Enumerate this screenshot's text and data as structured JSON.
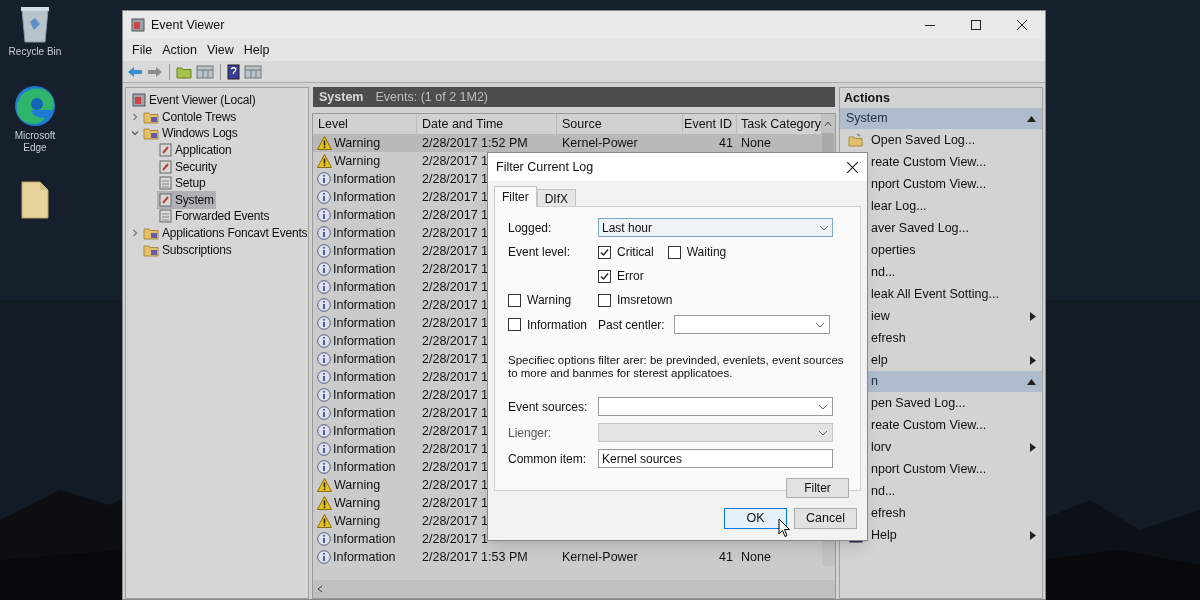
{
  "desktop": {
    "icons": [
      {
        "kind": "bin",
        "label": "Recycle Bin"
      },
      {
        "kind": "browser",
        "label": "Microsoft Edge"
      },
      {
        "kind": "file"
      }
    ]
  },
  "window": {
    "title": "Event Viewer"
  },
  "menu": [
    "File",
    "Action",
    "View",
    "Help"
  ],
  "tree": [
    {
      "label": "Event Viewer (Local)",
      "kind": "root",
      "selected": false,
      "children": [
        {
          "label": "Contole Trews",
          "kind": "folder",
          "selected": false,
          "expanded": false
        },
        {
          "label": "Windows Logs",
          "kind": "folder",
          "selected": false,
          "expanded": true,
          "children": [
            {
              "label": "Application",
              "kind": "log",
              "selected": false
            },
            {
              "label": "Security",
              "kind": "log",
              "selected": false
            },
            {
              "label": "Setup",
              "kind": "plain",
              "selected": false
            },
            {
              "label": "System",
              "kind": "log",
              "selected": true
            },
            {
              "label": "Forwarded Events",
              "kind": "plain",
              "selected": false
            }
          ]
        },
        {
          "label": "Applications Foncavt Events",
          "kind": "folder",
          "selected": false,
          "expanded": false
        },
        {
          "label": "Subscriptions",
          "kind": "folder",
          "selected": false
        }
      ]
    }
  ],
  "log_header": {
    "title": "System",
    "events": "Events: (1 of 2 1M2)"
  },
  "table": {
    "columns": [
      "Level",
      "Date and Time",
      "Source",
      "Event ID",
      "Task Category"
    ],
    "rows": [
      {
        "kind": "warning",
        "level": "Warning",
        "date": "2/28/2017 1:52 PM",
        "source": "Kernel-Power",
        "event_id": "41",
        "task_category": "None",
        "selected": true
      },
      {
        "kind": "warning",
        "level": "Warning",
        "date": "2/28/2017 1",
        "selected": false
      },
      {
        "kind": "info",
        "level": "Information",
        "date": "2/28/2017 1",
        "selected": false
      },
      {
        "kind": "info",
        "level": "Information",
        "date": "2/28/2017 1",
        "selected": false
      },
      {
        "kind": "info",
        "level": "Information",
        "date": "2/28/2017 1",
        "selected": false
      },
      {
        "kind": "info",
        "level": "Information",
        "date": "2/28/2017 1",
        "selected": false
      },
      {
        "kind": "info",
        "level": "Information",
        "date": "2/28/2017 1",
        "selected": false
      },
      {
        "kind": "info",
        "level": "Information",
        "date": "2/28/2017 1",
        "selected": false
      },
      {
        "kind": "info",
        "level": "Information",
        "date": "2/28/2017 1",
        "selected": false
      },
      {
        "kind": "info",
        "level": "Information",
        "date": "2/28/2017 1",
        "selected": false
      },
      {
        "kind": "info",
        "level": "Information",
        "date": "2/28/2017 1",
        "selected": false
      },
      {
        "kind": "info",
        "level": "Information",
        "date": "2/28/2017 1",
        "selected": false
      },
      {
        "kind": "info",
        "level": "Information",
        "date": "2/28/2017 1",
        "selected": false
      },
      {
        "kind": "info",
        "level": "Information",
        "date": "2/28/2017 1",
        "selected": false
      },
      {
        "kind": "info",
        "level": "Information",
        "date": "2/28/2017 1",
        "selected": false
      },
      {
        "kind": "info",
        "level": "Information",
        "date": "2/28/2017 1",
        "selected": false
      },
      {
        "kind": "info",
        "level": "Information",
        "date": "2/28/2017 1",
        "selected": false
      },
      {
        "kind": "info",
        "level": "Information",
        "date": "2/28/2017 1",
        "selected": false
      },
      {
        "kind": "info",
        "level": "Information",
        "date": "2/28/2017 1",
        "selected": false
      },
      {
        "kind": "warning",
        "level": "Warning",
        "date": "2/28/2017 1",
        "selected": false
      },
      {
        "kind": "warning",
        "level": "Warning",
        "date": "2/28/2017 1",
        "selected": false
      },
      {
        "kind": "warning",
        "level": "Warning",
        "date": "2/28/2017 1",
        "selected": false
      },
      {
        "kind": "info",
        "level": "Information",
        "date": "2/28/2017 1",
        "selected": false
      },
      {
        "kind": "info",
        "level": "Information",
        "date": "2/28/2017 1:53 PM",
        "source": "Kernel-Power",
        "event_id": "41",
        "task_category": "None",
        "selected": false
      }
    ]
  },
  "actions": {
    "title": "Actions",
    "sections": [
      {
        "title": "System",
        "expanded": true,
        "items": [
          {
            "label": "Open Saved Log...",
            "kind": "folder",
            "submenu": false
          },
          {
            "label": "reate Custom View...",
            "submenu": false
          },
          {
            "label": "nport Custom View...",
            "submenu": false
          },
          {
            "label": "lear Log...",
            "submenu": false
          },
          {
            "label": "aver Saved Log...",
            "submenu": false
          },
          {
            "label": "operties",
            "submenu": false
          },
          {
            "label": "nd...",
            "submenu": false
          },
          {
            "label": "leak All Event Sotting...",
            "submenu": false
          },
          {
            "label": "iew",
            "submenu": true
          },
          {
            "label": "efresh",
            "submenu": false
          },
          {
            "label": "elp",
            "submenu": true
          }
        ]
      },
      {
        "title": "n",
        "expanded": true,
        "items": [
          {
            "label": "pen Saved Log...",
            "submenu": false
          },
          {
            "label": "reate Custom View...",
            "submenu": false
          },
          {
            "label": "lorv",
            "submenu": true
          },
          {
            "label": "nport Custom View...",
            "submenu": false
          },
          {
            "label": "nd...",
            "submenu": false
          },
          {
            "label": "efresh",
            "submenu": false
          },
          {
            "label": "Help",
            "kind": "help",
            "submenu": true
          }
        ]
      }
    ]
  },
  "dialog": {
    "title": "Filter Current Log",
    "tabs": [
      {
        "label": "Filter",
        "selected": true
      },
      {
        "label": "DIfX",
        "selected": false
      }
    ],
    "logged": {
      "label": "Logged:",
      "value": "Last hour"
    },
    "event_level_label": "Event level:",
    "levels": [
      {
        "label": "Critical",
        "checked": true
      },
      {
        "label": "Waiting",
        "checked": false
      },
      {
        "label": "Error",
        "checked": true
      },
      {
        "label": "Warning",
        "checked": false
      },
      {
        "label": "Imsretown",
        "checked": false
      },
      {
        "label": "Information",
        "checked": false
      }
    ],
    "past_center": {
      "label": "Past centler:"
    },
    "description": "Specifiec options filter arer: be previnded, evenlets, event sources to more and banmes for sterest applicatoes.",
    "fields": [
      {
        "label": "Event sources:",
        "kind": "dropdown",
        "disabled": false
      },
      {
        "label": "Lienger:",
        "kind": "dropdown",
        "disabled": true
      },
      {
        "label": "Common item:",
        "kind": "text",
        "value": "Kernel sources"
      }
    ],
    "filter_button": "Filter",
    "buttons": [
      {
        "label": "OK",
        "focused": true
      },
      {
        "label": "Cancel",
        "focused": false
      }
    ]
  }
}
